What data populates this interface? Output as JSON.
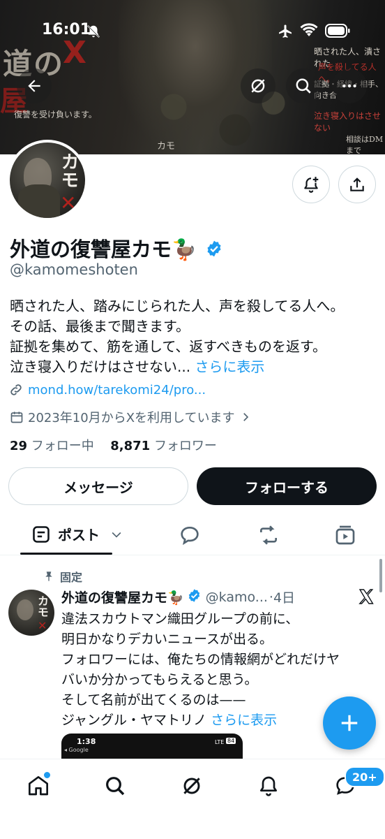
{
  "status_bar": {
    "time": "16:01"
  },
  "banner": {
    "title_part1": "道の",
    "title_part2": "屋",
    "mark": "X",
    "tagline": "復讐を受け負います。",
    "right_lines": [
      "晒された人、潰された",
      "声を殺してる人へ。",
      "証拠・経緯・相手、向き合",
      "泣き寝入りはさせない",
      "相談はDMまで"
    ],
    "kamo_mark": "カモ"
  },
  "profile": {
    "avatar_text": "カモ",
    "display_name": "外道の復讐屋カモ🦆",
    "handle": "@kamomeshoten",
    "bio_lines": [
      "晒された人、踏みにじられた人、声を殺してる人へ。",
      "その話、最後まで聞きます。",
      "証拠を集めて、筋を通して、返すべきものを返す。",
      "泣き寝入りだけはさせない..."
    ],
    "bio_more": "さらに表示",
    "link": "mond.how/tarekomi24/pro...",
    "joined": "2023年10月からXを利用しています",
    "following_count": "29",
    "following_label": "フォロー中",
    "followers_count": "8,871",
    "followers_label": "フォロワー"
  },
  "actions": {
    "message_label": "メッセージ",
    "follow_label": "フォローする"
  },
  "tabs": {
    "posts_label": "ポスト"
  },
  "pinned_post": {
    "pinned_label": "固定",
    "author_name": "外道の復讐屋カモ🦆",
    "author_handle": "@kamo...",
    "time_sep": "·",
    "time": "4日",
    "lines": [
      "違法スカウトマン織田グループの前に、",
      "明日かなりデカいニュースが出る。",
      "フォロワーには、俺たちの情報網がどれだけヤ",
      "バいか分かってもらえると思う。",
      "そして名前が出てくるのは——",
      "ジャングル・ヤマトリノ"
    ],
    "more": "さらに表示",
    "media_time": "1:38",
    "media_app": "◂ Google",
    "media_net": "LTE",
    "media_batt": "84"
  },
  "bottom_nav": {
    "messages_badge": "20+"
  },
  "colors": {
    "accent": "#1d9bf0",
    "text": "#0f1419",
    "muted": "#536471"
  }
}
